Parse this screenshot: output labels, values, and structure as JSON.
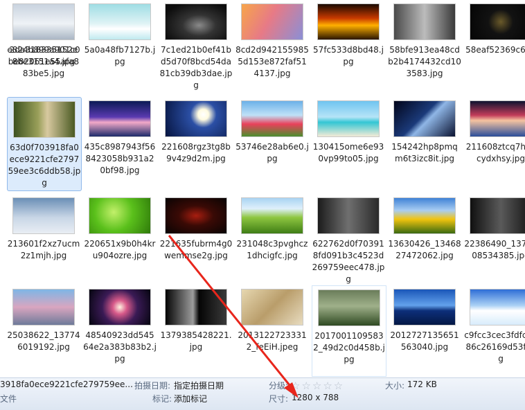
{
  "files": [
    {
      "name": "2da318335152ebe82061e55afa883be5.jpg",
      "thumb": "linear-gradient(#1e2a58 0%,#4a5d9c 55%,#a9b6d8 75%,#e8eef7 100%)"
    },
    {
      "name": "5a0a48fb7127b.jpg",
      "thumb": "linear-gradient(#9fdde4 0%,#dff3f5 55%,#ffffff 70%,#bfe9ef 100%)"
    },
    {
      "name": "7c1ed21b0ef41bd5d70f8bcd54da81cb39db3dae.jpg",
      "thumb": "radial-gradient(ellipse at 55% 60%,#8a8a8a 0%,#333 35%,#0d0d0d 80%)"
    },
    {
      "name": "8cd2d9421559855d153e872faf514137.jpg",
      "thumb": "linear-gradient(120deg,#f7a54a 0%,#e77a86 45%,#8a8fd6 100%)"
    },
    {
      "name": "57fc533d8bd48.jpg",
      "thumb": "linear-gradient(#1a0a00 0%,#c83a00 40%,#ffb000 60%,#2a1500 100%)"
    },
    {
      "name": "58bfe913ea48cdb2b4174432cd103583.jpg",
      "thumb": "linear-gradient(90deg,#4a4a4a 0%,#bcbcbc 50%,#3a3a3a 100%)"
    },
    {
      "name": "58eaf52369c6pg",
      "thumb": "radial-gradient(circle at 50% 50%,#6a5a2a 0%,#121212 35%,#050505 100%)"
    },
    {
      "name": "63d0f703918fa0ece9221cfe279759ee3c6ddb58.jpg",
      "thumb": "linear-gradient(90deg,#3d5220 0%,#9aa05a 40%,#d8c9a0 55%,#4a5a22 100%)"
    },
    {
      "name": "435c8987943f568423058b931a20bf98.jpg",
      "thumb": "linear-gradient(#0b1a55 0%,#5a3ab0 45%,#f2a9c8 60%,#1c2a6a 100%)"
    },
    {
      "name": "221608rgz3tg8b9v4z9d2m.jpg",
      "thumb": "radial-gradient(circle at 62% 38%,#ffffff 0%,#fffbe0 12%,#2b4fa5 30%,#06143f 100%)"
    },
    {
      "name": "53746e28ab6e0.jpg",
      "thumb": "linear-gradient(#6cb1e8 0%,#bfe1f7 40%,#e9415b 65%,#4b8f2e 100%)"
    },
    {
      "name": "130415ome6e930vp99to05.jpg",
      "thumb": "linear-gradient(#6fc4f0 0%,#b6e4f7 45%,#33c6d4 60%,#f3ebd6 100%)"
    },
    {
      "name": "154242hp8pmqm6t3izc8it.jpg",
      "thumb": "linear-gradient(135deg,#02051a 0%,#1b3a7a 45%,#8fb6e6 55%,#0a1230 100%)"
    },
    {
      "name": "211608ztcq7higicydxhsy.jpg",
      "thumb": "linear-gradient(#0e1330 0%,#c33c5a 40%,#f5c3a0 55%,#2a4d9a 100%)"
    },
    {
      "name": "213601f2xz7ucm2z1mjh.jpg",
      "thumb": "linear-gradient(#6b8fb6 0%,#c8d6e6 55%,#e9eef4 100%)"
    },
    {
      "name": "220651x9b0h4kru904ozre.jpg",
      "thumb": "radial-gradient(circle at 40% 40%,#c2f06a 0%,#5ac01b 45%,#2f7a0a 100%)"
    },
    {
      "name": "221635fubrm4g0wemmse2g.jpg",
      "thumb": "radial-gradient(ellipse at 50% 50%,#a81e10 0%,#3a0a05 40%,#080404 100%)"
    },
    {
      "name": "231048c3pvghcz1dhcigfc.jpg",
      "thumb": "linear-gradient(#a9d3f2 0%,#dff0fb 30%,#8ec640 55%,#3e7d15 100%)"
    },
    {
      "name": "622762d0f703918fd091b3c4523d269759eec478.jpg",
      "thumb": "linear-gradient(90deg,#1c1c1c 0%,#6f6f6f 50%,#2a2a2a 100%)"
    },
    {
      "name": "13630426_1346827472062.jpg",
      "thumb": "linear-gradient(#3f82d6 0%,#a9cdf2 35%,#f1c40f 60%,#3a6a10 100%)"
    },
    {
      "name": "22386490_1371808534385.jpg",
      "thumb": "linear-gradient(90deg,#101010 0%,#5a5a5a 50%,#141414 100%)"
    },
    {
      "name": "25038622_137746019192.jpg",
      "thumb": "linear-gradient(#7fb6e6 0%,#d9a6c0 50%,#6e7a99 100%)"
    },
    {
      "name": "48540923dd54564e2a383b83b2.jpg",
      "thumb": "radial-gradient(circle at 50% 50%,#fff3e0 0%,#d85a8a 20%,#3a1a55 50%,#05050f 100%)"
    },
    {
      "name": "1379385428221.jpg",
      "thumb": "linear-gradient(90deg,#050505 0%,#9c9c9c 45%,#050505 55%,#3a3a3a 100%)"
    },
    {
      "name": "20131227233312_feEiH.jpeg",
      "thumb": "linear-gradient(135deg,#e6d7b0 0%,#b99d6a 50%,#e8dcc0 100%)"
    },
    {
      "name": "20170011095832_49d2c0d458b.jpg",
      "thumb": "linear-gradient(#6a7d5a 0%,#9fb08a 45%,#2f4a22 100%)"
    },
    {
      "name": "2012727135651563040.jpg",
      "thumb": "linear-gradient(#1a56b8 0%,#63a2ec 45%,#0d2f7a 60%,#041845 100%)"
    },
    {
      "name": "c9fcc3cec3fdfc0386c26169d53f.jpg",
      "thumb": "linear-gradient(#2e6ed6 0%,#a9d0f5 45%,#ffffff 60%,#d8ecfb 100%)"
    },
    {
      "name": "e824b899a901c08be3151a4.jpg",
      "thumb": "linear-gradient(#c9d3df 0%,#eef2f6 55%,#aab6c4 100%)"
    }
  ],
  "status": {
    "filename": "3918fa0ece9221cfe279759ee...",
    "filetype": "文件",
    "date_key": "拍摄日期:",
    "date_val": "指定拍摄日期",
    "tag_key": "标记:",
    "tag_val": "添加标记",
    "rating_key": "分级:",
    "rating_stars": "☆☆☆☆☆",
    "size_key": "大小:",
    "size_val": "172 KB",
    "dim_key": "尺寸:",
    "dim_val": "1280 x 788"
  },
  "colors": {
    "annotation_arrow": "#e8261c"
  }
}
